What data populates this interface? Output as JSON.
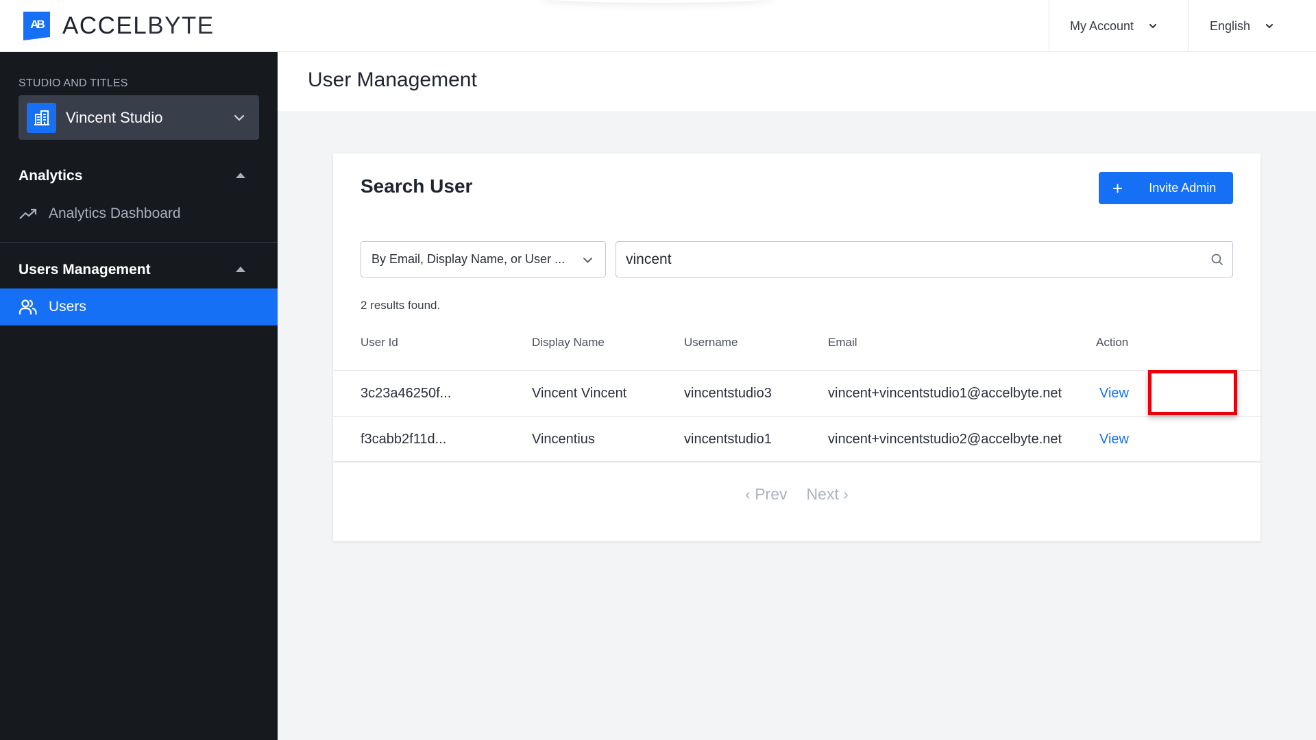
{
  "header": {
    "brand": {
      "mark": "AB",
      "name_part1": "ACCEL",
      "name_part2": "BYTE"
    },
    "account_menu": {
      "label": "My Account",
      "icon": "chevron-down-icon"
    },
    "language_menu": {
      "label": "English",
      "icon": "chevron-down-icon"
    }
  },
  "sidebar": {
    "studio_section_label": "STUDIO AND TITLES",
    "studio_selector": {
      "name": "Vincent Studio",
      "icon": "building-icon"
    },
    "groups": [
      {
        "label": "Analytics",
        "expanded": true,
        "items": [
          {
            "label": "Analytics Dashboard",
            "icon": "trending-up-icon",
            "active": false
          }
        ]
      },
      {
        "label": "Users Management",
        "expanded": true,
        "items": [
          {
            "label": "Users",
            "icon": "users-icon",
            "active": true
          }
        ]
      }
    ]
  },
  "page": {
    "title": "User Management"
  },
  "search_card": {
    "title": "Search User",
    "invite_button": {
      "icon": "plus-icon",
      "label": "Invite Admin"
    },
    "filter_select": {
      "selected": "By Email, Display Name, or User ..."
    },
    "search_input": {
      "value": "vincent",
      "icon": "search-icon"
    },
    "results_text": "2 results found.",
    "table": {
      "columns": [
        "User Id",
        "Display Name",
        "Username",
        "Email",
        "Action"
      ],
      "rows": [
        {
          "user_id": "3c23a46250f...",
          "display_name": "Vincent Vincent",
          "username": "vincentstudio3",
          "email": "vincent+vincentstudio1@accelbyte.net",
          "action": "View",
          "highlighted": true
        },
        {
          "user_id": "f3cabb2f11d...",
          "display_name": "Vincentius",
          "username": "vincentstudio1",
          "email": "vincent+vincentstudio2@accelbyte.net",
          "action": "View",
          "highlighted": false
        }
      ]
    },
    "pagination": {
      "prev": "Prev",
      "next": "Next",
      "prev_icon": "chevron-left-icon",
      "next_icon": "chevron-right-icon"
    }
  },
  "colors": {
    "accent": "#1670f5",
    "sidebar_bg": "#16191e",
    "studio_select_bg": "#393e4b",
    "content_bg": "#f3f4f6",
    "highlight_box": "#e8000b",
    "pagination_disabled": "#aab4c3"
  }
}
